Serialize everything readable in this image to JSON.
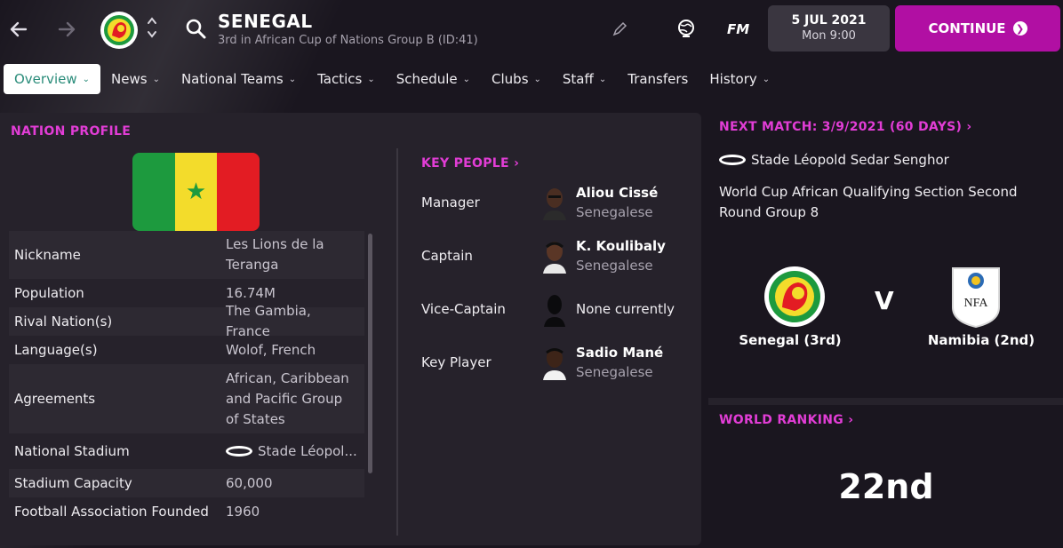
{
  "header": {
    "title": "SENEGAL",
    "subtitle": "3rd in African Cup of Nations Group B (ID:41)",
    "logo_text": "FM",
    "date": "5 JUL 2021",
    "time": "Mon 9:00",
    "continue_label": "CONTINUE"
  },
  "tabs": [
    {
      "label": "Overview",
      "active": true
    },
    {
      "label": "News"
    },
    {
      "label": "National Teams"
    },
    {
      "label": "Tactics"
    },
    {
      "label": "Schedule"
    },
    {
      "label": "Clubs"
    },
    {
      "label": "Staff"
    },
    {
      "label": "Transfers"
    },
    {
      "label": "History"
    }
  ],
  "profile": {
    "title": "NATION PROFILE",
    "rows": [
      {
        "key": "Nickname",
        "value": "Les Lions de la Teranga"
      },
      {
        "key": "Population",
        "value": "16.74M"
      },
      {
        "key": "Rival Nation(s)",
        "value": "The Gambia, France"
      },
      {
        "key": "Language(s)",
        "value": "Wolof, French"
      },
      {
        "key": "Agreements",
        "value": "African, Caribbean and Pacific Group of States"
      },
      {
        "key": "National Stadium",
        "value": "Stade Léopol..."
      },
      {
        "key": "Stadium Capacity",
        "value": "60,000"
      },
      {
        "key": "Football Association Founded",
        "value": "1960"
      }
    ]
  },
  "key_people": {
    "title": "KEY PEOPLE",
    "rows": [
      {
        "role": "Manager",
        "name": "Aliou Cissé",
        "nationality": "Senegalese"
      },
      {
        "role": "Captain",
        "name": "K. Koulibaly",
        "nationality": "Senegalese"
      },
      {
        "role": "Vice-Captain",
        "none": "None currently"
      },
      {
        "role": "Key Player",
        "name": "Sadio Mané",
        "nationality": "Senegalese"
      }
    ]
  },
  "next_match": {
    "title": "NEXT MATCH: 3/9/2021 (60 DAYS)",
    "venue": "Stade Léopold Sedar Senghor",
    "competition": "World Cup African Qualifying Section Second Round Group 8",
    "vs": "V",
    "home": "Senegal (3rd)",
    "away": "Namibia (2nd)",
    "away_badge_text": "NFA"
  },
  "world_ranking": {
    "title": "WORLD RANKING",
    "value": "22nd"
  },
  "colors": {
    "accent": "#e23dd6",
    "continue": "#b10fa3",
    "active_tab_text": "#2a8c7a"
  }
}
